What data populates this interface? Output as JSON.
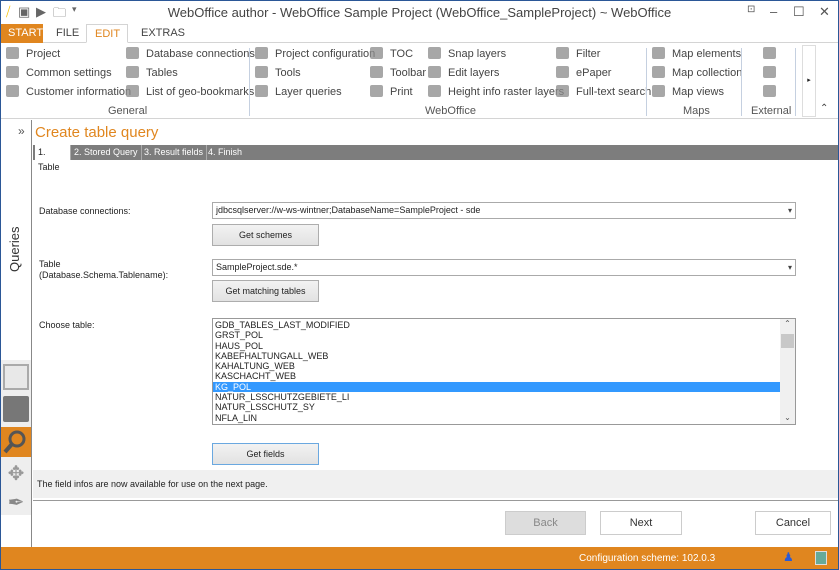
{
  "window": {
    "title": "WebOffice author - WebOffice Sample Project (WebOffice_SampleProject) ~ WebOffice",
    "controls": [
      "⊡",
      "–",
      "☐",
      "✕"
    ]
  },
  "menu_tabs": [
    "START",
    "FILE",
    "EDIT",
    "EXTRAS"
  ],
  "ribbon": {
    "general": {
      "label": "General",
      "items": [
        "Project",
        "Common settings",
        "Customer information",
        "Database connections",
        "Tables",
        "List of geo-bookmarks"
      ]
    },
    "weboffice": {
      "label": "WebOffice",
      "items": [
        "Project configuration",
        "Tools",
        "Layer queries",
        "TOC",
        "Toolbar",
        "Print",
        "Snap layers",
        "Edit layers",
        "Height info raster layers",
        "Filter",
        "ePaper",
        "Full-text search"
      ]
    },
    "maps": {
      "label": "Maps",
      "items": [
        "Map elements",
        "Map collection",
        "Map views"
      ]
    },
    "external": {
      "label": "External"
    }
  },
  "sidebar": {
    "expand": "»",
    "label": "Queries"
  },
  "wizard": {
    "title": "Create table query",
    "steps": [
      "1. Table",
      "2. Stored Query",
      "3. Result fields",
      "4. Finish"
    ],
    "db_label": "Database connections:",
    "db_value": "jdbcsqlserver://w-ws-wintner;DatabaseName=SampleProject - sde",
    "get_schemes": "Get schemes",
    "table_label": "Table",
    "table_label2": "(Database.Schema.Tablename):",
    "table_value": "SampleProject.sde.*",
    "get_tables": "Get matching tables",
    "choose_label": "Choose table:",
    "tables": [
      "GDB_TABLES_LAST_MODIFIED",
      "GRST_POL",
      "HAUS_POL",
      "KABEFHALTUNGALL_WEB",
      "KAHALTUNG_WEB",
      "KASCHACHT_WEB",
      "KG_POL",
      "NATUR_LSSCHUTZGEBIETE_LI",
      "NATUR_LSSCHUTZ_SY",
      "NFLA_LIN"
    ],
    "selected_table": "KG_POL",
    "get_fields": "Get fields",
    "info": "The field infos are now available for use on the next page.",
    "back": "Back",
    "next": "Next",
    "cancel": "Cancel"
  },
  "status": {
    "config": "Configuration scheme:  102.0.3"
  },
  "colors": {
    "accent": "#e0861f",
    "selection": "#3399ff"
  }
}
